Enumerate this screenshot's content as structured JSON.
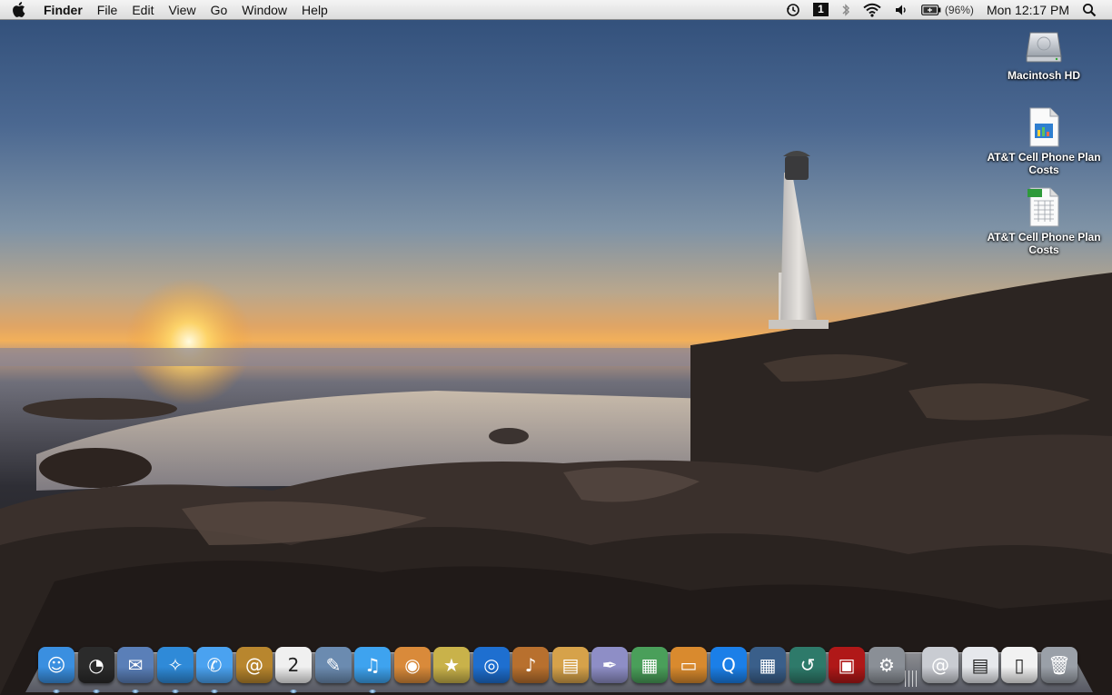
{
  "menubar": {
    "app_name": "Finder",
    "menus": [
      "File",
      "Edit",
      "View",
      "Go",
      "Window",
      "Help"
    ],
    "status": {
      "time_machine_icon": "time-machine-icon",
      "spaces_number": "1",
      "battery_percent": "(96%)",
      "clock": "Mon 12:17 PM"
    }
  },
  "desktop": {
    "icons": [
      {
        "label": "Macintosh HD",
        "icon": "hard-drive-icon"
      },
      {
        "label": "AT&T Cell Phone Plan Costs",
        "icon": "numbers-document-icon"
      },
      {
        "label": "AT&T Cell Phone Plan Costs",
        "icon": "excel-spreadsheet-icon"
      }
    ]
  },
  "dock": {
    "items": [
      {
        "name": "finder",
        "glyph": "☺",
        "color": "#3a8fe0",
        "running": true
      },
      {
        "name": "dashboard",
        "glyph": "◔",
        "color": "#2b2b2b",
        "running": true
      },
      {
        "name": "mail",
        "glyph": "✉",
        "color": "#5a7fb8",
        "running": true
      },
      {
        "name": "safari",
        "glyph": "✧",
        "color": "#2f8ad8",
        "running": true
      },
      {
        "name": "ichat",
        "glyph": "✆",
        "color": "#4aa2f0",
        "running": true
      },
      {
        "name": "address-book",
        "glyph": "@",
        "color": "#b8862e",
        "running": false
      },
      {
        "name": "ical",
        "glyph": "2",
        "color": "#f0f0f0",
        "running": true
      },
      {
        "name": "preview",
        "glyph": "✎",
        "color": "#6b8bb0",
        "running": false
      },
      {
        "name": "itunes",
        "glyph": "♫",
        "color": "#3ea3ef",
        "running": true
      },
      {
        "name": "iphoto",
        "glyph": "◉",
        "color": "#d98a3a",
        "running": false
      },
      {
        "name": "imovie",
        "glyph": "★",
        "color": "#c9b24a",
        "running": false
      },
      {
        "name": "idvd",
        "glyph": "◎",
        "color": "#1e6fd0",
        "running": false
      },
      {
        "name": "garageband",
        "glyph": "♪",
        "color": "#b8702e",
        "running": false
      },
      {
        "name": "iweb",
        "glyph": "▤",
        "color": "#d6a24a",
        "running": false
      },
      {
        "name": "pages",
        "glyph": "✒",
        "color": "#8e8ec6",
        "running": false
      },
      {
        "name": "numbers",
        "glyph": "▦",
        "color": "#4a9f5a",
        "running": false
      },
      {
        "name": "keynote",
        "glyph": "▭",
        "color": "#d98a2e",
        "running": false
      },
      {
        "name": "quicktime",
        "glyph": "Q",
        "color": "#1b7fe8",
        "running": false
      },
      {
        "name": "spaces",
        "glyph": "▦",
        "color": "#3a5f8a",
        "running": false
      },
      {
        "name": "time-machine",
        "glyph": "↺",
        "color": "#2e7a6a",
        "running": false
      },
      {
        "name": "photo-booth",
        "glyph": "▣",
        "color": "#b01818",
        "running": false
      },
      {
        "name": "system-preferences",
        "glyph": "⚙",
        "color": "#8a8f96",
        "running": false
      },
      {
        "name": "downloads-stack",
        "glyph": "@",
        "color": "#c9ccd2",
        "running": false
      },
      {
        "name": "documents-stack",
        "glyph": "▤",
        "color": "#e6e8ec",
        "running": false
      },
      {
        "name": "file-document",
        "glyph": "▯",
        "color": "#f2f2f2",
        "running": false
      },
      {
        "name": "trash",
        "glyph": "🗑",
        "color": "#9aa0a8",
        "running": false
      }
    ]
  },
  "colors": {
    "menubar_top": "#f4f4f4",
    "menubar_bottom": "#dcdcdc",
    "sky_top": "#2f4d78",
    "sunset": "#f2b05a"
  }
}
